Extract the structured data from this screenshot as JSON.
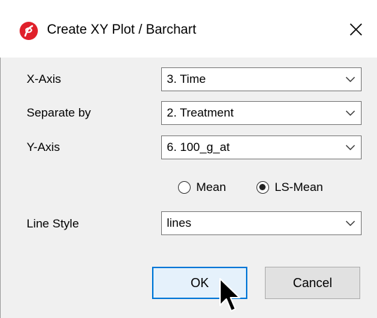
{
  "window": {
    "title": "Create XY Plot / Barchart",
    "app_icon": "partek-logo-icon",
    "close_icon": "close-icon"
  },
  "form": {
    "x_axis": {
      "label": "X-Axis",
      "value": "3. Time"
    },
    "separate_by": {
      "label": "Separate by",
      "value": "2. Treatment"
    },
    "y_axis": {
      "label": "Y-Axis",
      "value": "6. 100_g_at"
    },
    "statistic": {
      "options": [
        {
          "label": "Mean",
          "checked": false
        },
        {
          "label": "LS-Mean",
          "checked": true
        }
      ]
    },
    "line_style": {
      "label": "Line Style",
      "value": "lines"
    }
  },
  "buttons": {
    "ok_label": "OK",
    "cancel_label": "Cancel"
  },
  "colors": {
    "accent": "#0078d7",
    "icon_red": "#e0202a",
    "client_bg": "#f0f0f0"
  }
}
